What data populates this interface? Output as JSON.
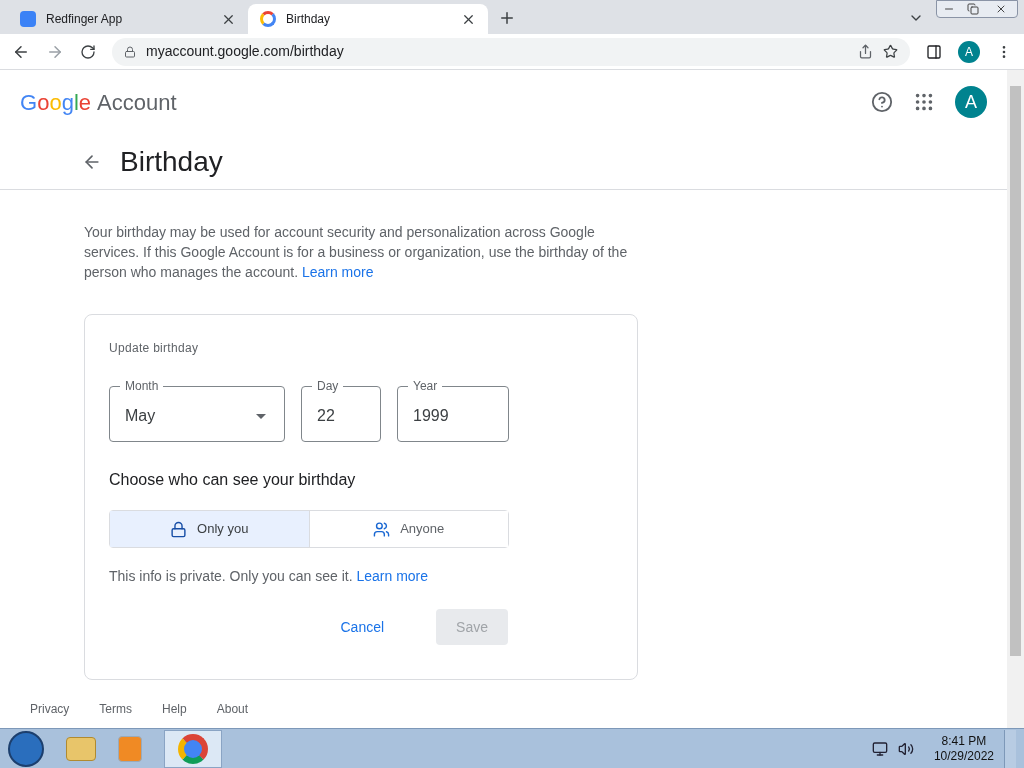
{
  "browser": {
    "tabs": [
      {
        "title": "Redfinger App",
        "selected": false
      },
      {
        "title": "Birthday",
        "selected": true
      }
    ],
    "url": "myaccount.google.com/birthday",
    "profile_initial": "A"
  },
  "header": {
    "logo": "Google",
    "product": "Account",
    "avatar_initial": "A"
  },
  "page": {
    "title": "Birthday",
    "intro": "Your birthday may be used for account security and personalization across Google services. If this Google Account is for a business or organization, use the birthday of the person who manages the account.",
    "intro_link": "Learn more"
  },
  "card": {
    "heading": "Update birthday",
    "fields": [
      {
        "kind": "select",
        "label": "Month",
        "value": "May"
      },
      {
        "kind": "text",
        "label": "Day",
        "value": "22"
      },
      {
        "kind": "text",
        "label": "Year",
        "value": "1999"
      }
    ],
    "visibility_title": "Choose who can see your birthday",
    "visibility_options": [
      {
        "kind": "lock",
        "label": "Only you",
        "selected": true
      },
      {
        "kind": "people",
        "label": "Anyone",
        "selected": false
      }
    ],
    "note": "This info is private. Only you can see it.",
    "note_link": "Learn more",
    "buttons": [
      {
        "label": "Cancel",
        "disabled": false,
        "kind": "text"
      },
      {
        "label": "Save",
        "disabled": true,
        "kind": "filled"
      }
    ]
  },
  "footer": [
    "Privacy",
    "Terms",
    "Help",
    "About"
  ],
  "taskbar": {
    "time": "8:41 PM",
    "date": "10/29/2022"
  }
}
